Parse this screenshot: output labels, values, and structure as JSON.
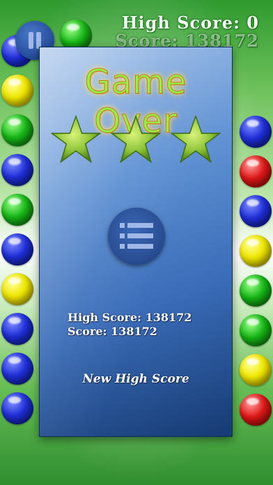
{
  "hud": {
    "high_score_text": "High Score: 0",
    "score_text": "Score: 138172",
    "pause_icon": "pause-icon"
  },
  "game_over": {
    "title": "Game Over",
    "stars_earned": 3,
    "stars_total": 3,
    "star_icon": "star-icon",
    "menu_icon": "menu-list-icon",
    "high_score_text": "High Score: 138172",
    "score_text": "Score: 138172",
    "new_high_score_text": "New High Score"
  },
  "colors": {
    "panel_blue": "#3a6cb8",
    "title_green": "#96f04a",
    "star_green": "#8fc53a",
    "ball_blue": "#1f2fd8",
    "ball_green": "#17b817",
    "ball_yellow": "#f1e800",
    "ball_red": "#e01818"
  },
  "balls": {
    "left_column": [
      "blue",
      "yellow",
      "green",
      "blue",
      "green",
      "blue",
      "yellow",
      "blue",
      "blue",
      "blue"
    ],
    "right_column": [
      "blue",
      "red",
      "blue",
      "yellow",
      "green",
      "green",
      "yellow",
      "red"
    ],
    "top_row": [
      "green",
      "blue"
    ]
  }
}
